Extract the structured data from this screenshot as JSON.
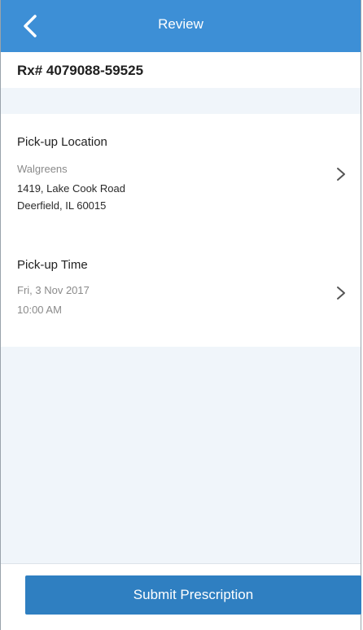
{
  "navbar": {
    "title": "Review",
    "back_icon": "chevron-left-icon",
    "color": "#3d8fd6"
  },
  "prescription": {
    "rx_number": "Rx# 4079088-59525"
  },
  "pickup_location": {
    "heading": "Pick-up Location",
    "store": "Walgreens",
    "address_line1": "1419, Lake Cook Road",
    "address_line2": "Deerfield, IL 60015",
    "chevron_icon": "chevron-right-icon"
  },
  "pickup_time": {
    "heading": "Pick-up Time",
    "date": "Fri, 3 Nov 2017",
    "time": "10:00 AM",
    "chevron_icon": "chevron-right-icon"
  },
  "actions": {
    "submit_label": "Submit Prescription",
    "submit_color": "#2f7fc1"
  },
  "colors": {
    "page_background": "#f0f5fa",
    "card_background": "#ffffff",
    "muted_text": "#8a8a8a"
  }
}
